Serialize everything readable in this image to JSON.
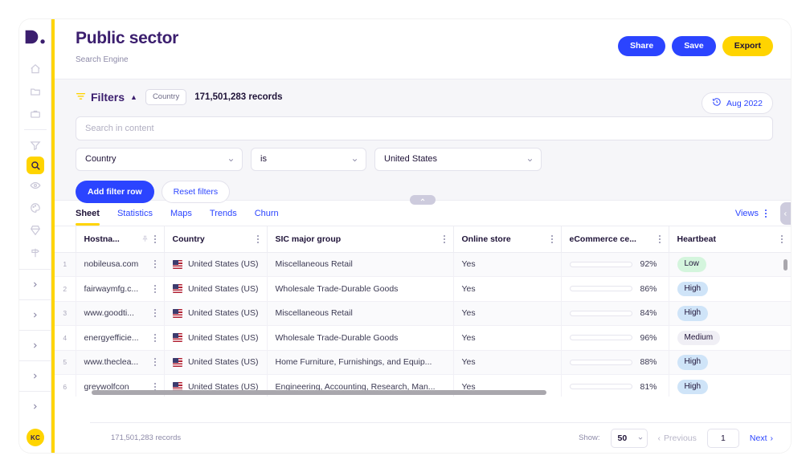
{
  "app": {
    "logo_text": "D.",
    "avatar_initials": "KC"
  },
  "sidebar": {
    "icons": [
      {
        "name": "home-icon"
      },
      {
        "name": "folder-icon"
      },
      {
        "name": "briefcase-icon"
      },
      {
        "name": "filter-funnel-icon"
      },
      {
        "name": "search-icon",
        "active": true
      },
      {
        "name": "eye-icon"
      },
      {
        "name": "palette-icon"
      },
      {
        "name": "diamond-icon"
      },
      {
        "name": "signpost-icon"
      }
    ],
    "chevron_count": 5
  },
  "header": {
    "title": "Public sector",
    "subtitle": "Search Engine",
    "share_label": "Share",
    "save_label": "Save",
    "export_label": "Export"
  },
  "filters": {
    "title": "Filters",
    "chip": "Country",
    "records": "171,501,283 records",
    "date_pill": "Aug 2022",
    "search_placeholder": "Search in content",
    "search_value": "",
    "field": "Country",
    "operator": "is",
    "value": "United States",
    "add_filter_label": "Add filter row",
    "reset_label": "Reset filters"
  },
  "tabs": {
    "items": [
      {
        "label": "Sheet",
        "active": true
      },
      {
        "label": "Statistics",
        "active": false
      },
      {
        "label": "Maps",
        "active": false
      },
      {
        "label": "Trends",
        "active": false
      },
      {
        "label": "Churn",
        "active": false
      }
    ],
    "views_label": "Views"
  },
  "table": {
    "columns": [
      {
        "label": "Hostna...",
        "pin": true
      },
      {
        "label": "Country"
      },
      {
        "label": "SIC major group"
      },
      {
        "label": "Online store"
      },
      {
        "label": "eCommerce ce..."
      },
      {
        "label": "Heartbeat"
      }
    ],
    "rows": [
      {
        "index": "1",
        "hostname": "nobileusa.com",
        "country": "United States (US)",
        "sic": "Miscellaneous Retail",
        "online_store": "Yes",
        "ecommerce_pct": 92,
        "ecommerce_label": "92%",
        "heartbeat": "Low",
        "heartbeat_kind": "low"
      },
      {
        "index": "2",
        "hostname": "fairwaymfg.c...",
        "country": "United States (US)",
        "sic": "Wholesale Trade-Durable Goods",
        "online_store": "Yes",
        "ecommerce_pct": 86,
        "ecommerce_label": "86%",
        "heartbeat": "High",
        "heartbeat_kind": "high"
      },
      {
        "index": "3",
        "hostname": "www.goodti...",
        "country": "United States (US)",
        "sic": "Miscellaneous Retail",
        "online_store": "Yes",
        "ecommerce_pct": 84,
        "ecommerce_label": "84%",
        "heartbeat": "High",
        "heartbeat_kind": "high"
      },
      {
        "index": "4",
        "hostname": "energyefficie...",
        "country": "United States (US)",
        "sic": "Wholesale Trade-Durable Goods",
        "online_store": "Yes",
        "ecommerce_pct": 96,
        "ecommerce_label": "96%",
        "heartbeat": "Medium",
        "heartbeat_kind": "medium"
      },
      {
        "index": "5",
        "hostname": "www.theclea...",
        "country": "United States (US)",
        "sic": "Home Furniture, Furnishings, and Equip...",
        "online_store": "Yes",
        "ecommerce_pct": 88,
        "ecommerce_label": "88%",
        "heartbeat": "High",
        "heartbeat_kind": "high"
      },
      {
        "index": "6",
        "hostname": "greywolfcon",
        "country": "United States (US)",
        "sic": "Engineering, Accounting, Research, Man...",
        "online_store": "Yes",
        "ecommerce_pct": 81,
        "ecommerce_label": "81%",
        "heartbeat": "High",
        "heartbeat_kind": "high"
      }
    ]
  },
  "footer": {
    "records": "171,501,283 records",
    "show_label": "Show:",
    "page_size": "50",
    "previous_label": "Previous",
    "page_value": "1",
    "next_label": "Next"
  },
  "colors": {
    "brand_purple": "#3b1e6e",
    "accent_yellow": "#FFD400",
    "accent_blue": "#2B44FF",
    "bar_green": "#4CC764",
    "badge_low": "#d4f5dd",
    "badge_high": "#cfe4f8",
    "badge_medium": "#f0eff5"
  }
}
